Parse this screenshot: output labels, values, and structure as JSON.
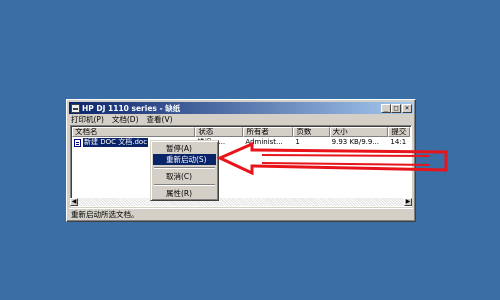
{
  "window": {
    "title": "HP DJ 1110 series - 缺纸",
    "controls": {
      "minimize": "_",
      "maximize": "□",
      "close": "×"
    }
  },
  "menubar": {
    "items": [
      "打印机(P)",
      "文档(D)",
      "查看(V)"
    ]
  },
  "listview": {
    "columns": [
      "文档名",
      "状态",
      "所有者",
      "页数",
      "大小",
      "提交"
    ],
    "rows": [
      {
        "document": "新建 DOC 文档.doc",
        "status": "错误 - ...",
        "owner": "Administ...",
        "pages": "1",
        "size": "9.93 KB/9.9...",
        "submitted": "14:1"
      }
    ]
  },
  "context_menu": {
    "items": [
      "暂停(A)",
      "重新启动(S)",
      "取消(C)",
      "属性(R)"
    ]
  },
  "statusbar": {
    "text": "重新启动所选文档。"
  },
  "colors": {
    "desktop": "#3a6ea5",
    "title_active": "#0a246a",
    "highlight": "#0a246a",
    "annotation_arrow": "#e8141c"
  },
  "icons": [
    "printer-icon",
    "document-icon",
    "scroll-left-icon",
    "scroll-right-icon"
  ]
}
